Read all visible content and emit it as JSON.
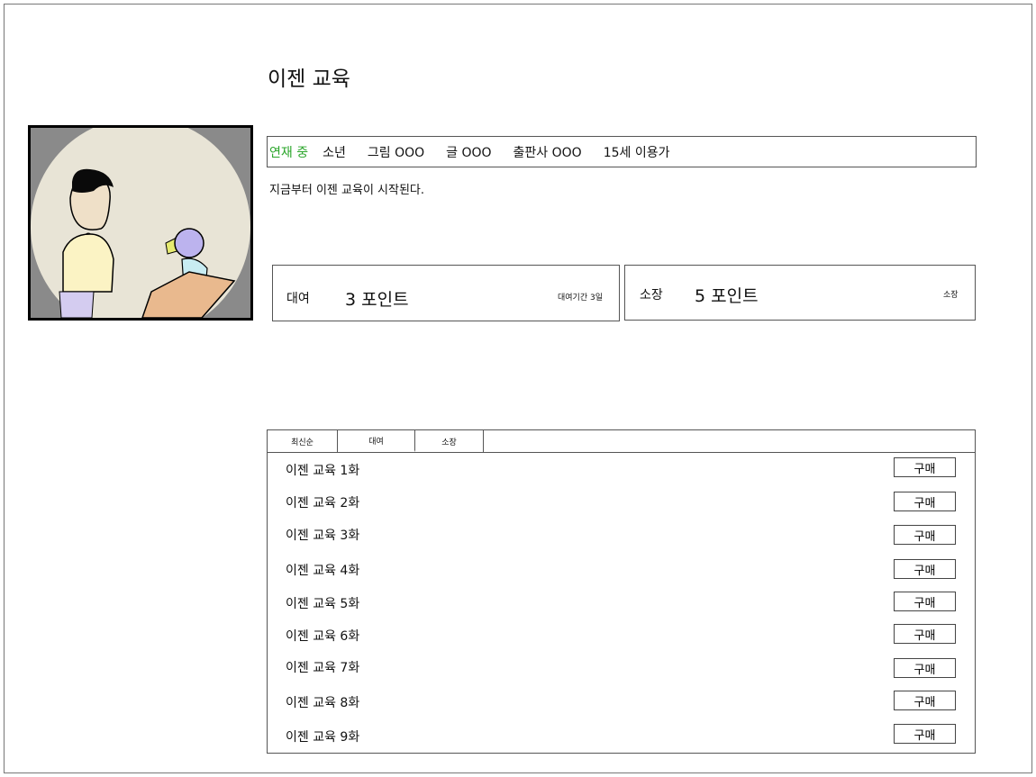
{
  "title": "이젠 교육",
  "cover": {
    "alt": "이젠 교육 표지"
  },
  "meta": {
    "status": "연재 중",
    "genre": "소년",
    "illustrator": "그림 OOO",
    "writer": "글 OOO",
    "publisher": "출판사 OOO",
    "age_rating": "15세 이용가"
  },
  "description": "지금부터 이젠 교육이 시작된다.",
  "rent": {
    "label": "대여",
    "points": "3 포인트",
    "note": "대여기간 3일"
  },
  "own": {
    "label": "소장",
    "points": "5 포인트",
    "note": "소장"
  },
  "tabs": [
    "최신순",
    "대여",
    "소장"
  ],
  "episodes": [
    {
      "title": "이젠 교육 1화",
      "button": "구매"
    },
    {
      "title": "이젠 교육 2화",
      "button": "구매"
    },
    {
      "title": "이젠 교육 3화",
      "button": "구매"
    },
    {
      "title": "이젠 교육 4화",
      "button": "구매"
    },
    {
      "title": "이젠 교육 5화",
      "button": "구매"
    },
    {
      "title": "이젠 교육 6화",
      "button": "구매"
    },
    {
      "title": "이젠 교육 7화",
      "button": "구매"
    },
    {
      "title": "이젠 교육 8화",
      "button": "구매"
    },
    {
      "title": "이젠 교육 9화",
      "button": "구매"
    }
  ],
  "colors": {
    "status": "#2aa52a",
    "border": "#555555",
    "cover_bg": "#8a8a8a",
    "cover_circle": "#e8e4d6"
  }
}
